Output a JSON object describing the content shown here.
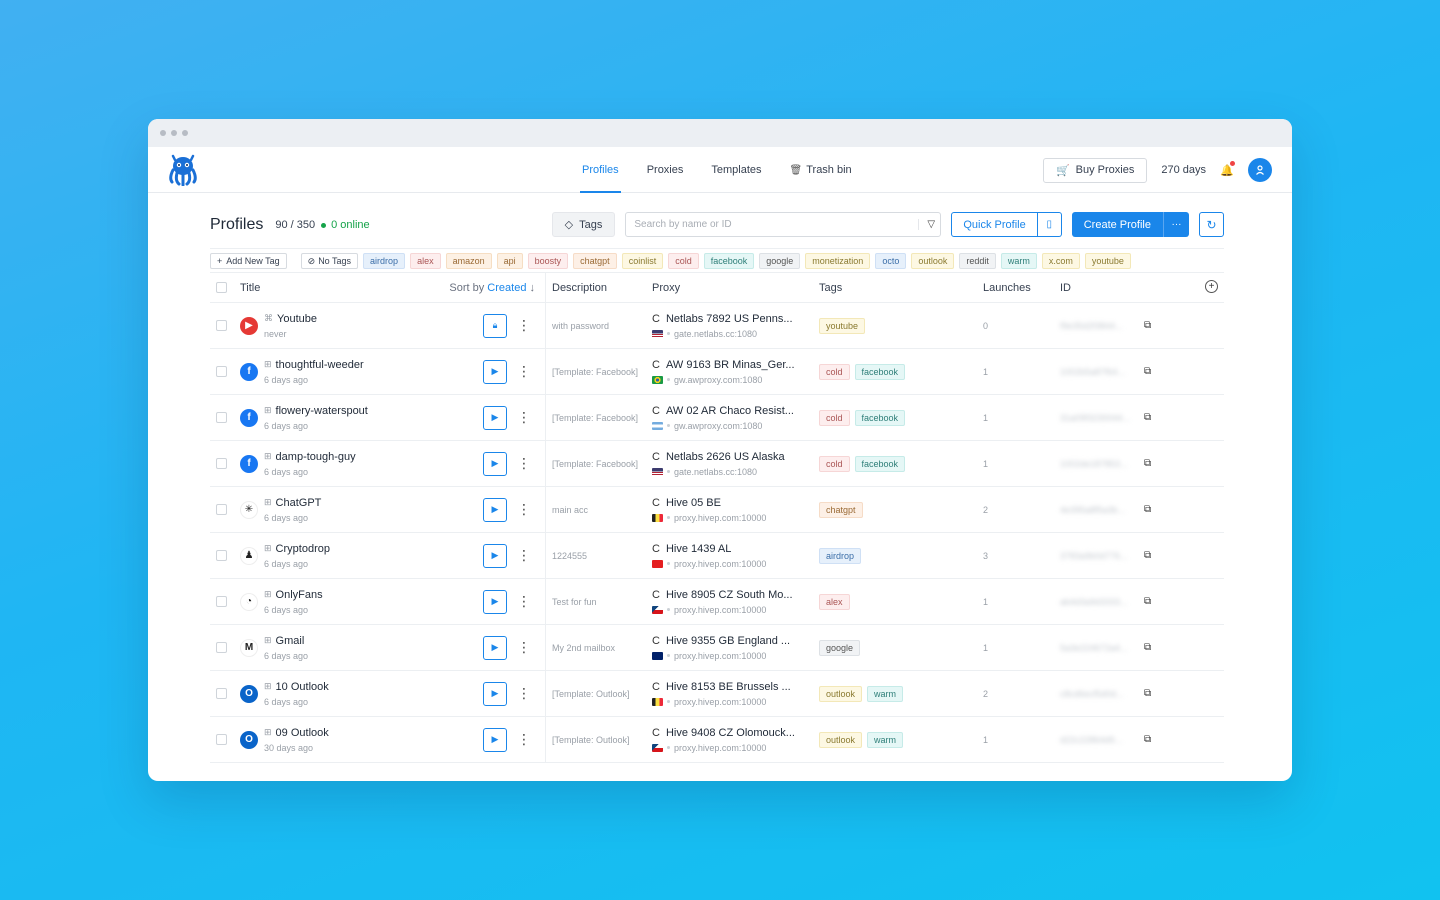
{
  "nav": {
    "items": [
      "Profiles",
      "Proxies",
      "Templates",
      "Trash bin"
    ]
  },
  "topbar": {
    "buy_proxies": "Buy Proxies",
    "days": "270 days"
  },
  "header": {
    "title": "Profiles",
    "count": "90 / 350",
    "online": "0 online",
    "tags_button": "Tags",
    "search_placeholder": "Search by name or ID",
    "quick_profile": "Quick Profile",
    "create_profile": "Create Profile"
  },
  "tagbar": {
    "add_new_tag": "Add New Tag",
    "no_tags": "No Tags",
    "tags": [
      {
        "label": "airdrop",
        "bg": "#e6f0fb",
        "border": "#cfe0f5",
        "color": "#3b6ea8"
      },
      {
        "label": "alex",
        "bg": "#fdeeee",
        "border": "#f6d6d6",
        "color": "#a55"
      },
      {
        "label": "amazon",
        "bg": "#fdf1e4",
        "border": "#f6dec3",
        "color": "#9a6a35"
      },
      {
        "label": "api",
        "bg": "#fdf1e4",
        "border": "#f6dec3",
        "color": "#9a6a35"
      },
      {
        "label": "boosty",
        "bg": "#fdeeee",
        "border": "#f6d6d6",
        "color": "#a55"
      },
      {
        "label": "chatgpt",
        "bg": "#fdf0e6",
        "border": "#f6dcc7",
        "color": "#9a6a35"
      },
      {
        "label": "coinlist",
        "bg": "#fdf8e3",
        "border": "#f3e8b8",
        "color": "#8a7a30"
      },
      {
        "label": "cold",
        "bg": "#fdeeee",
        "border": "#f6d6d6",
        "color": "#a55"
      },
      {
        "label": "facebook",
        "bg": "#e5f7f6",
        "border": "#c6ebe8",
        "color": "#2f7f79"
      },
      {
        "label": "google",
        "bg": "#f1f3f5",
        "border": "#dde1e5",
        "color": "#555"
      },
      {
        "label": "monetization",
        "bg": "#fdf8e3",
        "border": "#f3e8b8",
        "color": "#8a7a30"
      },
      {
        "label": "octo",
        "bg": "#e6f0fb",
        "border": "#cfe0f5",
        "color": "#3b6ea8"
      },
      {
        "label": "outlook",
        "bg": "#fdf8e3",
        "border": "#f3e8b8",
        "color": "#8a7a30"
      },
      {
        "label": "reddit",
        "bg": "#f1f3f5",
        "border": "#dde1e5",
        "color": "#555"
      },
      {
        "label": "warm",
        "bg": "#e5f7f6",
        "border": "#c6ebe8",
        "color": "#2f7f79"
      },
      {
        "label": "x.com",
        "bg": "#fdf8e3",
        "border": "#f3e8b8",
        "color": "#8a7a30"
      },
      {
        "label": "youtube",
        "bg": "#fdf8e3",
        "border": "#f3e8b8",
        "color": "#8a7a30"
      }
    ]
  },
  "table": {
    "headers": {
      "title": "Title",
      "sort_by": "Sort by",
      "sort_field": "Created",
      "description": "Description",
      "proxy": "Proxy",
      "tags": "Tags",
      "launches": "Launches",
      "id": "ID"
    },
    "rows": [
      {
        "name": "Youtube",
        "sub": "never",
        "icon": "youtube-icon",
        "icon_bg": "#e53935",
        "icon_glyph": "▶",
        "os": "apple",
        "desc": "with password",
        "proxy": "Netlabs 7892 US Penns...",
        "host": "gate.netlabs.cc:1080",
        "flag": "us",
        "tags": [
          "youtube"
        ],
        "launches": "0",
        "id": "f9e35d2f3844...",
        "locked": true
      },
      {
        "name": "thoughtful-weeder",
        "sub": "6 days ago",
        "icon": "facebook-icon",
        "icon_bg": "#1877f2",
        "icon_glyph": "f",
        "os": "windows",
        "desc": "[Template: Facebook]",
        "proxy": "AW 9163 BR Minas_Ger...",
        "host": "gw.awproxy.com:1080",
        "flag": "br",
        "tags": [
          "cold",
          "facebook"
        ],
        "launches": "1",
        "id": "1002b5a87f64...",
        "locked": false
      },
      {
        "name": "flowery-waterspout",
        "sub": "6 days ago",
        "icon": "facebook-icon",
        "icon_bg": "#1877f2",
        "icon_glyph": "f",
        "os": "windows",
        "desc": "[Template: Facebook]",
        "proxy": "AW 02 AR Chaco Resist...",
        "host": "gw.awproxy.com:1080",
        "flag": "ar",
        "tags": [
          "cold",
          "facebook"
        ],
        "launches": "1",
        "id": "31a09f3230044...",
        "locked": false
      },
      {
        "name": "damp-tough-guy",
        "sub": "6 days ago",
        "icon": "facebook-icon",
        "icon_bg": "#1877f2",
        "icon_glyph": "f",
        "os": "windows",
        "desc": "[Template: Facebook]",
        "proxy": "Netlabs 2626 US Alaska",
        "host": "gate.netlabs.cc:1080",
        "flag": "us",
        "tags": [
          "cold",
          "facebook"
        ],
        "launches": "1",
        "id": "1002de187853...",
        "locked": false
      },
      {
        "name": "ChatGPT",
        "sub": "6 days ago",
        "icon": "openai-icon",
        "icon_bg": "#ffffff",
        "icon_glyph": "✳",
        "os": "windows",
        "desc": "main acc",
        "proxy": "Hive 05 BE",
        "host": "proxy.hivep.com:10000",
        "flag": "be",
        "tags": [
          "chatgpt"
        ],
        "launches": "2",
        "id": "4e395a8f5a3b...",
        "locked": false
      },
      {
        "name": "Cryptodrop",
        "sub": "6 days ago",
        "icon": "cryptodrop-icon",
        "icon_bg": "#ffffff",
        "icon_glyph": "♟",
        "os": "windows",
        "desc": "1224555",
        "proxy": "Hive 1439 AL",
        "host": "proxy.hivep.com:10000",
        "flag": "al",
        "tags": [
          "airdrop"
        ],
        "launches": "3",
        "id": "3783a9b0d776...",
        "locked": false
      },
      {
        "name": "OnlyFans",
        "sub": "6 days ago",
        "icon": "onlyfans-icon",
        "icon_bg": "#ffffff",
        "icon_glyph": "◔",
        "os": "windows",
        "desc": "Test for fun",
        "proxy": "Hive 8905 CZ South Mo...",
        "host": "proxy.hivep.com:10000",
        "flag": "cz",
        "tags": [
          "alex"
        ],
        "launches": "1",
        "id": "ab4d3a9d3333...",
        "locked": false
      },
      {
        "name": "Gmail",
        "sub": "6 days ago",
        "icon": "gmail-icon",
        "icon_bg": "#ffffff",
        "icon_glyph": "M",
        "os": "windows",
        "desc": "My 2nd mailbox",
        "proxy": "Hive 9355 GB England ...",
        "host": "proxy.hivep.com:10000",
        "flag": "gb",
        "tags": [
          "google"
        ],
        "launches": "1",
        "id": "5a3e224672a4...",
        "locked": false
      },
      {
        "name": "10 Outlook",
        "sub": "6 days ago",
        "icon": "outlook-icon",
        "icon_bg": "#0a64c9",
        "icon_glyph": "O",
        "os": "windows",
        "desc": "[Template: Outlook]",
        "proxy": "Hive 8153 BE Brussels ...",
        "host": "proxy.hivep.com:10000",
        "flag": "be",
        "tags": [
          "outlook",
          "warm"
        ],
        "launches": "2",
        "id": "c8cd6ecf5d0d...",
        "locked": false
      },
      {
        "name": "09 Outlook",
        "sub": "30 days ago",
        "icon": "outlook-icon",
        "icon_bg": "#0a64c9",
        "icon_glyph": "O",
        "os": "windows",
        "desc": "[Template: Outlook]",
        "proxy": "Hive 9408 CZ Olomouck...",
        "host": "proxy.hivep.com:10000",
        "flag": "cz",
        "tags": [
          "outlook",
          "warm"
        ],
        "launches": "1",
        "id": "d22c22864d9...",
        "locked": false
      }
    ]
  }
}
